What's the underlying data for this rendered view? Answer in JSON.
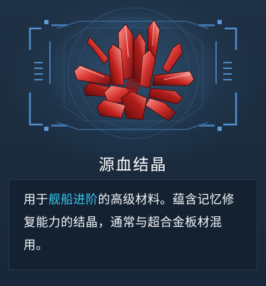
{
  "item": {
    "name": "源血结晶",
    "icon": "red-crystal-cluster-icon"
  },
  "description": {
    "prefix": "用于",
    "highlight": "舰船进阶",
    "suffix": "的高级材料。蕴含记忆修复能力的结晶，通常与超合金板材混用。"
  },
  "colors": {
    "highlight": "#39c6f2",
    "text": "#f2f5f8",
    "background": "#1b2a3b",
    "frame": "#4f8fcf"
  }
}
